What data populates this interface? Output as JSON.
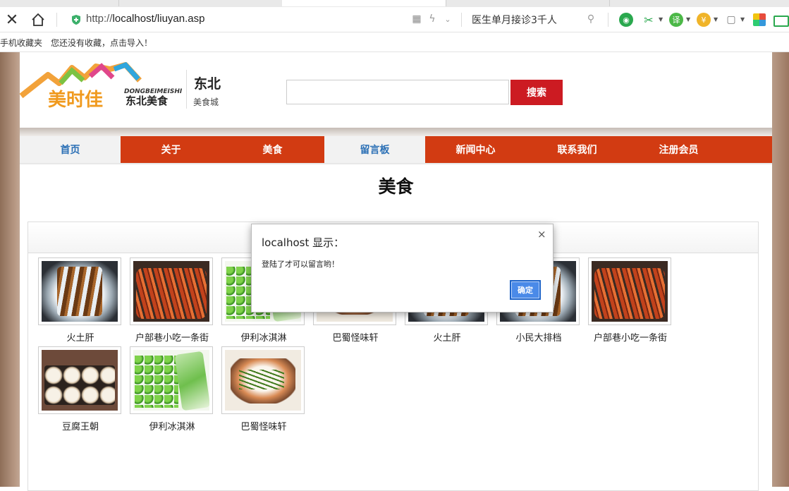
{
  "browser": {
    "url_prefix": "http://",
    "url_host_path": "localhost/liuyan.asp",
    "search_promo": "医生单月接诊3千人",
    "bookmarks": {
      "folder": "手机收藏夹",
      "hint": "您还没有收藏，点击导入！"
    },
    "icons": [
      "close-icon",
      "home-icon",
      "shield-icon",
      "qr-icon",
      "lightning-icon",
      "search-icon",
      "extension-icons"
    ]
  },
  "site": {
    "brand_name": "东北",
    "brand_sub": "美食城",
    "search_button": "搜索",
    "nav": [
      "首页",
      "关于",
      "美食",
      "留言板",
      "新闻中心",
      "联系我们",
      "注册会员"
    ],
    "nav_active": [
      "首页",
      "留言板"
    ],
    "page_title": "美食"
  },
  "gallery": [
    {
      "caption": "火土肝",
      "art": "kebab"
    },
    {
      "caption": "户部巷小吃一条街",
      "art": "sausage"
    },
    {
      "caption": "伊利冰淇淋",
      "art": "peas"
    },
    {
      "caption": "巴蜀怪味轩",
      "art": "fish"
    },
    {
      "caption": "火土肝",
      "art": "kebab"
    },
    {
      "caption": "小民大排档",
      "art": "kebab"
    },
    {
      "caption": "户部巷小吃一条街",
      "art": "sausage"
    },
    {
      "caption": "豆腐王朝",
      "art": "sushi"
    },
    {
      "caption": "伊利冰淇淋",
      "art": "peas"
    },
    {
      "caption": "巴蜀怪味轩",
      "art": "fish"
    }
  ],
  "dialog": {
    "title": "localhost 显示：",
    "message": "登陆了才可以留言哟！",
    "ok": "确定",
    "close": "×"
  },
  "colors": {
    "nav_red": "#d23b12",
    "search_red": "#cc1b22",
    "link_blue": "#2a6fb5",
    "ok_blue": "#4a8ae8"
  }
}
